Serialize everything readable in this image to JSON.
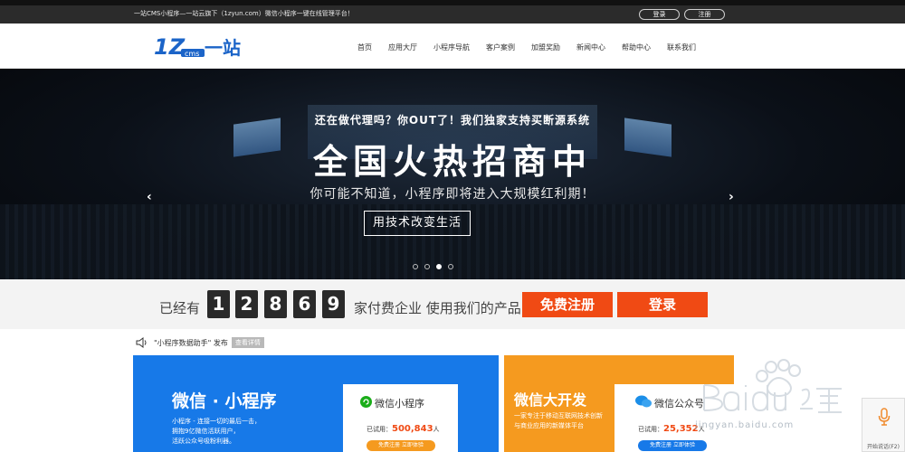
{
  "topbar": {
    "text": "一站CMS小程序—一站云旗下（1zyun.com）微信小程序一键在线管理平台！",
    "login": "登录",
    "register": "注册"
  },
  "header": {
    "logo_mark": "1Z",
    "logo_sub": "cms",
    "logo_text": "一站",
    "nav": [
      "首页",
      "应用大厅",
      "小程序导航",
      "客户案例",
      "加盟奖励",
      "新闻中心",
      "帮助中心",
      "联系我们"
    ]
  },
  "banner": {
    "line1": "还在做代理吗？你OUT了！我们独家支持买断源系统",
    "line2": "全国火热招商中",
    "line3": "你可能不知道，小程序即将进入大规模红利期！",
    "button": "用技术改变生活",
    "prev": "‹",
    "next": "›",
    "slides": 4,
    "active_slide": 3
  },
  "counter": {
    "prefix": "已经有",
    "digits": [
      "1",
      "2",
      "8",
      "6",
      "9"
    ],
    "suffix": "家付费企业 使用我们的产品",
    "register": "免费注册",
    "login": "登录"
  },
  "notice": {
    "text": "\"小程序数据助手\" 发布",
    "tag": "查看详情"
  },
  "cards": {
    "mini": {
      "title": "微信 · 小程序",
      "desc": [
        "小程序 - 连接一切的最后一击，",
        "拥抱9亿微信活跃用户，",
        "活跃公众号吸粉利器。"
      ],
      "panel_title": "微信小程序",
      "count_label": "已试用：",
      "count": "500,843",
      "count_unit": "人",
      "button": "免费注册  立即体验"
    },
    "dev": {
      "title": "微信大开发",
      "desc": [
        "一家专注于移动互联网技术创新",
        "与商业应用的新媒体平台"
      ],
      "panel_title": "微信公众号",
      "count_label": "已试用：",
      "count": "25,352",
      "count_unit": "人",
      "button": "免费注册  立即体验"
    }
  },
  "watermark": {
    "url": "jingyan.baidu.com"
  },
  "voice": {
    "label": "开始说话(F2)"
  },
  "colors": {
    "accent_orange": "#f04a14",
    "card_blue": "#1779e8",
    "card_orange": "#f59a1f",
    "topbar": "#2b2b2b"
  }
}
